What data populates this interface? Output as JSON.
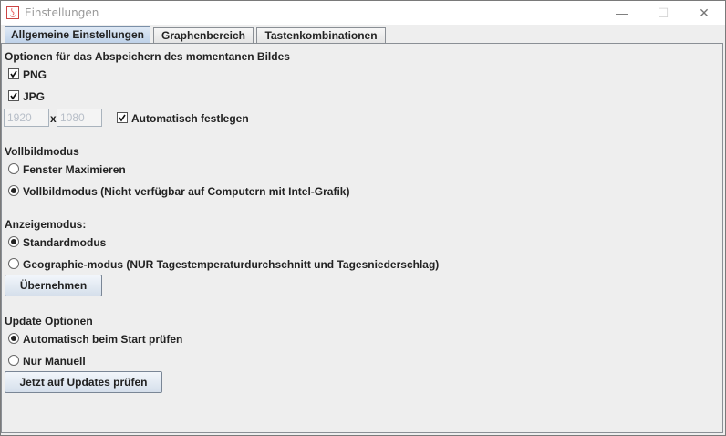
{
  "window": {
    "title": "Einstellungen",
    "minimize_glyph": "—",
    "maximize_glyph": "☐",
    "close_glyph": "✕"
  },
  "tabs": [
    {
      "label": "Allgemeine Einstellungen",
      "active": true
    },
    {
      "label": "Graphenbereich",
      "active": false
    },
    {
      "label": "Tastenkombinationen",
      "active": false
    }
  ],
  "image_save": {
    "heading": "Optionen für das Abspeichern des momentanen Bildes",
    "png_label": "PNG",
    "png_checked": true,
    "jpg_label": "JPG",
    "jpg_checked": true,
    "width_placeholder": "1920",
    "separator": "x",
    "height_placeholder": "1080",
    "auto_label": "Automatisch festlegen",
    "auto_checked": true
  },
  "fullscreen": {
    "heading": "Vollbildmodus",
    "options": [
      {
        "label": "Fenster Maximieren",
        "selected": false
      },
      {
        "label": "Vollbildmodus (Nicht verfügbar auf Computern mit Intel-Grafik)",
        "selected": true
      }
    ]
  },
  "display_mode": {
    "heading": "Anzeigemodus:",
    "options": [
      {
        "label": "Standardmodus",
        "selected": true
      },
      {
        "label": "Geographie-modus (NUR Tagestemperaturdurchschnitt und Tagesniederschlag)",
        "selected": false
      }
    ],
    "apply_button": "Übernehmen"
  },
  "updates": {
    "heading": "Update Optionen",
    "options": [
      {
        "label": "Automatisch beim Start prüfen",
        "selected": true
      },
      {
        "label": "Nur Manuell",
        "selected": false
      }
    ],
    "check_button": "Jetzt auf Updates prüfen"
  }
}
